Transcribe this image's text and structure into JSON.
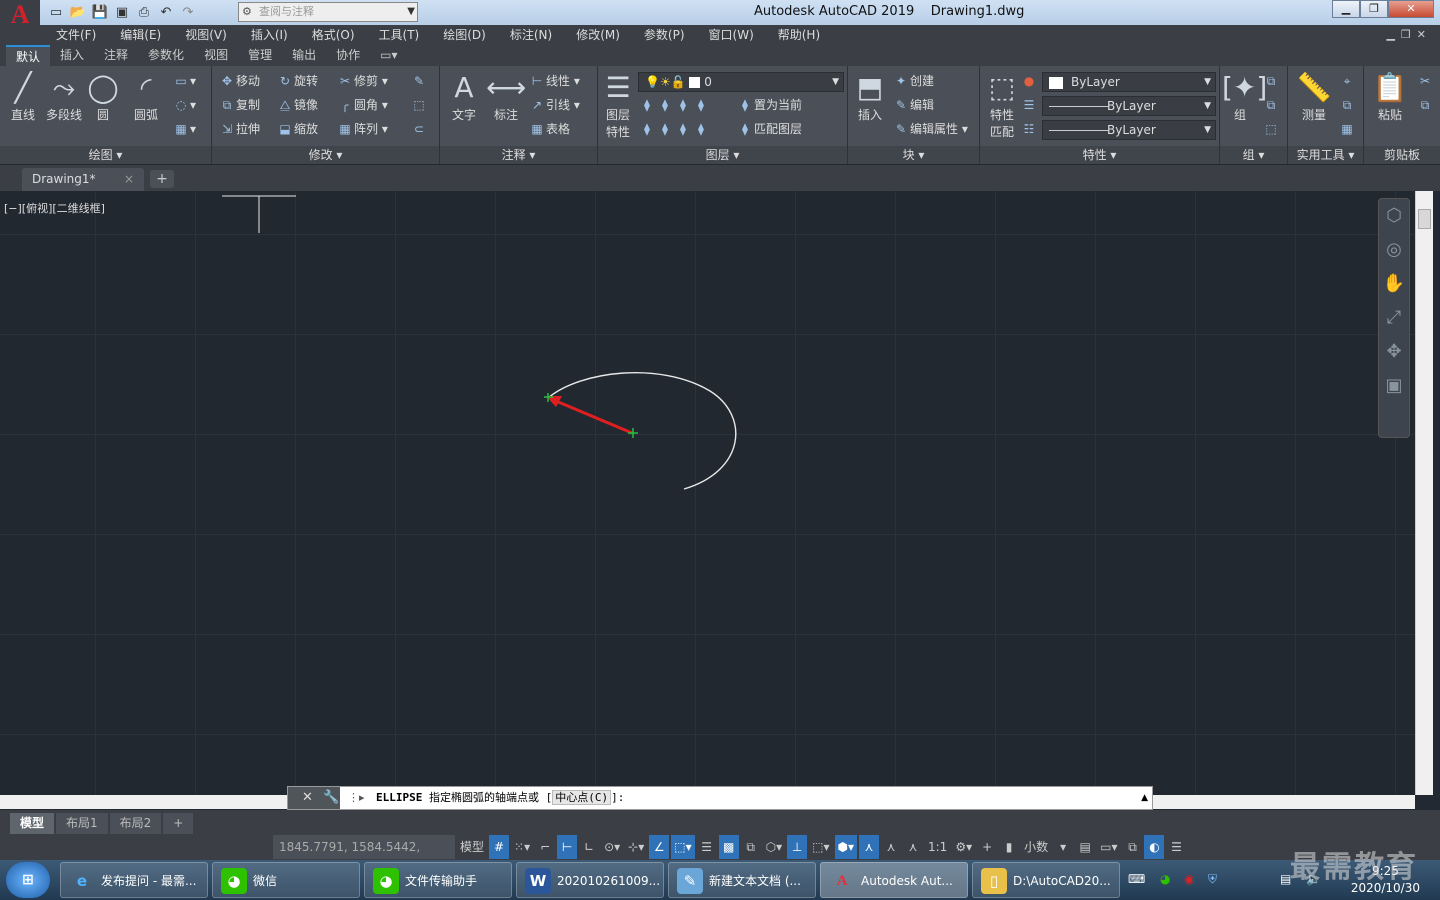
{
  "title": {
    "app": "Autodesk AutoCAD 2019",
    "file": "Drawing1.dwg",
    "logo": "A",
    "workspace_placeholder": "查阅与注释"
  },
  "menu": [
    "文件(F)",
    "编辑(E)",
    "视图(V)",
    "插入(I)",
    "格式(O)",
    "工具(T)",
    "绘图(D)",
    "标注(N)",
    "修改(M)",
    "参数(P)",
    "窗口(W)",
    "帮助(H)"
  ],
  "ribbon_tabs": [
    "默认",
    "插入",
    "注释",
    "参数化",
    "视图",
    "管理",
    "输出",
    "协作"
  ],
  "ribbon": {
    "draw": {
      "line": "直线",
      "polyline": "多段线",
      "circle": "圆",
      "arc": "圆弧",
      "title": "绘图 ▾"
    },
    "modify": {
      "move": "移动",
      "rotate": "旋转",
      "trim": "修剪",
      "copy": "复制",
      "mirror": "镜像",
      "fillet": "圆角",
      "stretch": "拉伸",
      "scale": "缩放",
      "array": "阵列",
      "title": "修改 ▾"
    },
    "annotation": {
      "text": "文字",
      "dimension": "标注",
      "linear": "线性",
      "leader": "引线",
      "table": "表格",
      "title": "注释 ▾"
    },
    "layers": {
      "props_line1": "图层",
      "props_line2": "特性",
      "current_layer": "0",
      "set_current": "置为当前",
      "match_layer": "匹配图层",
      "title": "图层 ▾"
    },
    "block": {
      "insert": "插入",
      "create": "创建",
      "edit": "编辑",
      "edit_attr": "编辑属性",
      "title": "块 ▾"
    },
    "properties": {
      "match_line1": "特性",
      "match_line2": "匹配",
      "color": "ByLayer",
      "linetype": "ByLayer",
      "lineweight": "ByLayer",
      "title": "特性 ▾"
    },
    "groups": {
      "group": "组",
      "title": "组 ▾"
    },
    "utilities": {
      "measure": "测量",
      "title": "实用工具 ▾"
    },
    "clipboard": {
      "paste": "粘贴",
      "title": "剪贴板"
    }
  },
  "doc_tab": {
    "name": "Drawing1*",
    "close": "×",
    "new": "+"
  },
  "viewport_label": "[−][俯视][二维线框]",
  "command": {
    "name": "ELLIPSE",
    "prompt": "指定椭圆弧的轴端点或",
    "option_open": "[",
    "option": "中心点(C)",
    "option_close": "]:"
  },
  "layout_tabs": [
    "模型",
    "布局1",
    "布局2",
    "+"
  ],
  "status": {
    "coords": "1845.7791, 1584.5442, 0.0000",
    "model": "模型",
    "scale": "1:1",
    "units": "小数"
  },
  "taskbar": [
    {
      "label": "发布提问 - 最需...",
      "icon": "ie-icon",
      "color": "#1e88e5"
    },
    {
      "label": "微信",
      "icon": "wechat-icon",
      "color": "#2dc100"
    },
    {
      "label": "文件传输助手",
      "icon": "wechat-icon",
      "color": "#2dc100"
    },
    {
      "label": "202010261009...",
      "icon": "word-icon",
      "color": "#2b579a"
    },
    {
      "label": "新建文本文档 (...",
      "icon": "notepad-icon",
      "color": "#6aa6d8"
    },
    {
      "label": "Autodesk Aut...",
      "icon": "autocad-icon",
      "color": "#c8202a"
    },
    {
      "label": "D:\\AutoCAD20...",
      "icon": "folder-icon",
      "color": "#e8c04a"
    }
  ],
  "clock": {
    "time": "9:25",
    "date": "2020/10/30"
  },
  "watermark": "最需教育",
  "colors": {
    "canvas": "#212830",
    "arrow": "#e02020",
    "marker": "#20c040",
    "ellipse": "#e8e8e8",
    "accent": "#2f72b8"
  }
}
